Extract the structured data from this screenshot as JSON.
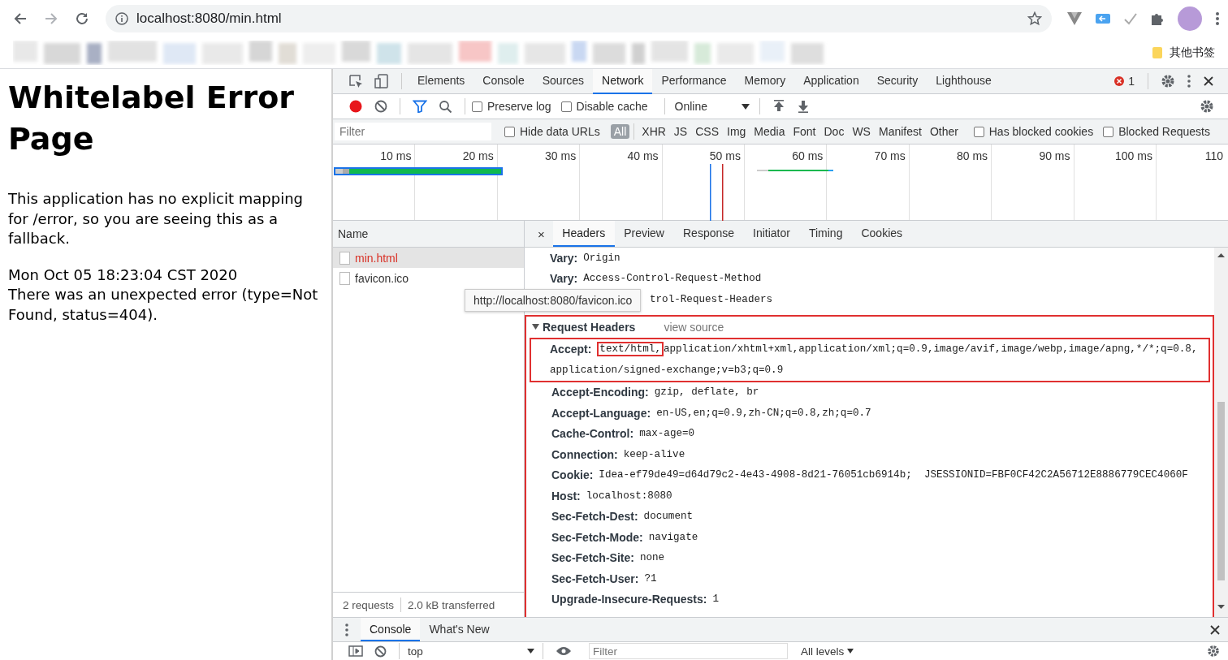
{
  "browser": {
    "url": "localhost:8080/min.html",
    "bookmark_folder": "其他书签"
  },
  "page": {
    "title": "Whitelabel Error Page",
    "message": "This application has no explicit mapping for /error, so you are seeing this as a fallback.",
    "timestamp": "Mon Oct 05 18:23:04 CST 2020",
    "error": "There was an unexpected error (type=Not Found, status=404)."
  },
  "devtools": {
    "tabs": [
      {
        "label": "Elements",
        "selected": false
      },
      {
        "label": "Console",
        "selected": false
      },
      {
        "label": "Sources",
        "selected": false
      },
      {
        "label": "Network",
        "selected": true
      },
      {
        "label": "Performance",
        "selected": false
      },
      {
        "label": "Memory",
        "selected": false
      },
      {
        "label": "Application",
        "selected": false
      },
      {
        "label": "Security",
        "selected": false
      },
      {
        "label": "Lighthouse",
        "selected": false
      }
    ],
    "error_count": "1",
    "toolbar": {
      "recording": true,
      "preserve_log": {
        "label": "Preserve log",
        "checked": false
      },
      "disable_cache": {
        "label": "Disable cache",
        "checked": false
      },
      "throttling": "Online"
    },
    "filter": {
      "placeholder": "Filter",
      "hide_data_urls": {
        "label": "Hide data URLs",
        "checked": false
      },
      "types": [
        {
          "label": "All",
          "selected": true
        },
        {
          "label": "XHR",
          "selected": false
        },
        {
          "label": "JS",
          "selected": false
        },
        {
          "label": "CSS",
          "selected": false
        },
        {
          "label": "Img",
          "selected": false
        },
        {
          "label": "Media",
          "selected": false
        },
        {
          "label": "Font",
          "selected": false
        },
        {
          "label": "Doc",
          "selected": false
        },
        {
          "label": "WS",
          "selected": false
        },
        {
          "label": "Manifest",
          "selected": false
        },
        {
          "label": "Other",
          "selected": false
        }
      ],
      "has_blocked_cookies": {
        "label": "Has blocked cookies",
        "checked": false
      },
      "blocked_requests": {
        "label": "Blocked Requests",
        "checked": false
      }
    },
    "timeline_ticks": [
      "10 ms",
      "20 ms",
      "30 ms",
      "40 ms",
      "50 ms",
      "60 ms",
      "70 ms",
      "80 ms",
      "90 ms",
      "100 ms",
      "110"
    ],
    "requests": {
      "column": "Name",
      "rows": [
        {
          "name": "min.html",
          "failed": true,
          "selected": true
        },
        {
          "name": "favicon.ico",
          "failed": false,
          "selected": false
        }
      ]
    },
    "tooltip": "http://localhost:8080/favicon.ico",
    "status": [
      "2 requests",
      "2.0 kB transferred"
    ],
    "detail_tabs": [
      {
        "label": "Headers",
        "selected": true
      },
      {
        "label": "Preview",
        "selected": false
      },
      {
        "label": "Response",
        "selected": false
      },
      {
        "label": "Initiator",
        "selected": false
      },
      {
        "label": "Timing",
        "selected": false
      },
      {
        "label": "Cookies",
        "selected": false
      }
    ],
    "detail_close": "×",
    "response_headers": [
      {
        "name": "Vary:",
        "value": "Origin",
        "covered": false
      },
      {
        "name": "Vary:",
        "value": "Access-Control-Request-Method",
        "covered": false
      },
      {
        "value": "trol-Request-Headers",
        "covered": true
      }
    ],
    "request_headers": {
      "title": "Request Headers",
      "expanded": true,
      "highlighted": true,
      "link": "view source",
      "rows": [
        {
          "name": "Accept:",
          "highlighted": true,
          "lines": [
            [
              {
                "text": "text/html,",
                "highlighted": true
              },
              {
                "text": "application/xhtml+xml,application/xml;q=0.9,image/avif,image/webp,image/apng,*/*;q=0.8,",
                "highlighted": false
              }
            ],
            [
              {
                "text": "application/signed-exchange;v=b3;q=0.9",
                "highlighted": false
              }
            ]
          ]
        },
        {
          "name": "Accept-Encoding:",
          "highlighted": false,
          "lines": [
            [
              {
                "text": "gzip, deflate, br",
                "highlighted": false
              }
            ]
          ]
        },
        {
          "name": "Accept-Language:",
          "highlighted": false,
          "lines": [
            [
              {
                "text": "en-US,en;q=0.9,zh-CN;q=0.8,zh;q=0.7",
                "highlighted": false
              }
            ]
          ]
        },
        {
          "name": "Cache-Control:",
          "highlighted": false,
          "lines": [
            [
              {
                "text": "max-age=0",
                "highlighted": false
              }
            ]
          ]
        },
        {
          "name": "Connection:",
          "highlighted": false,
          "lines": [
            [
              {
                "text": "keep-alive",
                "highlighted": false
              }
            ]
          ]
        },
        {
          "name": "Cookie:",
          "highlighted": false,
          "lines": [
            [
              {
                "text": "Idea-ef79de49=d64d79c2-4e43-4908-8d21-76051cb6914b;  JSESSIONID=FBF0CF42C2A56712E8886779CEC4060F",
                "highlighted": false
              }
            ]
          ]
        },
        {
          "name": "Host:",
          "highlighted": false,
          "lines": [
            [
              {
                "text": "localhost:8080",
                "highlighted": false
              }
            ]
          ]
        },
        {
          "name": "Sec-Fetch-Dest:",
          "highlighted": false,
          "lines": [
            [
              {
                "text": "document",
                "highlighted": false
              }
            ]
          ]
        },
        {
          "name": "Sec-Fetch-Mode:",
          "highlighted": false,
          "lines": [
            [
              {
                "text": "navigate",
                "highlighted": false
              }
            ]
          ]
        },
        {
          "name": "Sec-Fetch-Site:",
          "highlighted": false,
          "lines": [
            [
              {
                "text": "none",
                "highlighted": false
              }
            ]
          ]
        },
        {
          "name": "Sec-Fetch-User:",
          "highlighted": false,
          "lines": [
            [
              {
                "text": "?1",
                "highlighted": false
              }
            ]
          ]
        },
        {
          "name": "Upgrade-Insecure-Requests:",
          "highlighted": false,
          "lines": [
            [
              {
                "text": "1",
                "highlighted": false
              }
            ]
          ]
        }
      ]
    },
    "drawer": {
      "tabs": [
        {
          "label": "Console",
          "selected": true
        },
        {
          "label": "What's New",
          "selected": false
        }
      ],
      "context": "top",
      "filter_placeholder": "Filter",
      "levels": "All levels"
    }
  }
}
